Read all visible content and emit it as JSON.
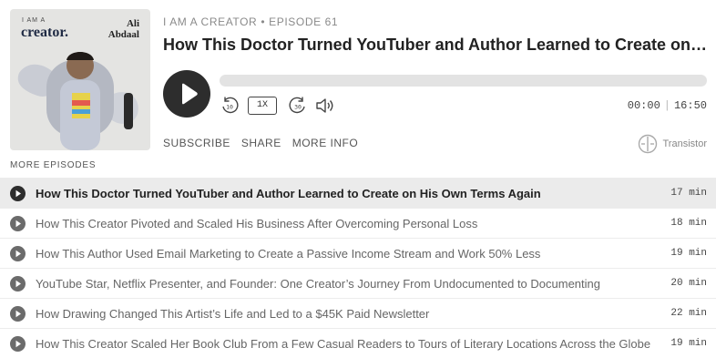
{
  "cover": {
    "small_text": "I AM A",
    "big_text": "creator.",
    "author_line1": "Ali",
    "author_line2": "Abdaal"
  },
  "podcast": {
    "show": "I AM A CREATOR",
    "separator": "•",
    "episode": "EPISODE 61",
    "title": "How This Doctor Turned YouTuber and Author Learned to Create on His Own Terms Again"
  },
  "player": {
    "speed_label": "1X",
    "rewind_seconds": "10",
    "forward_seconds": "30",
    "current_time": "00:00",
    "duration": "16:50",
    "progress_fraction": 0,
    "icons": [
      "play-icon",
      "rewind-10-icon",
      "forward-30-icon",
      "volume-icon"
    ]
  },
  "links": {
    "subscribe": "SUBSCRIBE",
    "share": "SHARE",
    "more_info": "MORE INFO"
  },
  "brand": {
    "name": "Transistor"
  },
  "episodes_label": "MORE EPISODES",
  "episodes": [
    {
      "title": "How This Doctor Turned YouTuber and Author Learned to Create on His Own Terms Again",
      "duration": "17 min",
      "active": true
    },
    {
      "title": "How This Creator Pivoted and Scaled His Business After Overcoming Personal Loss",
      "duration": "18 min",
      "active": false
    },
    {
      "title": "How This Author Used Email Marketing to Create a Passive Income Stream and Work 50% Less",
      "duration": "19 min",
      "active": false
    },
    {
      "title": "YouTube Star, Netflix Presenter, and Founder: One Creator’s Journey From Undocumented to Documenting",
      "duration": "20 min",
      "active": false
    },
    {
      "title": "How Drawing Changed This Artist’s Life and Led to a $45K Paid Newsletter",
      "duration": "22 min",
      "active": false
    },
    {
      "title": "How This Creator Scaled Her Book Club From a Few Casual Readers to Tours of Literary Locations Across the Globe",
      "duration": "19 min",
      "active": false
    }
  ],
  "colors": {
    "play_button": "#2d2d2d",
    "progress_track": "#e3e3e3",
    "active_row": "#ebebeb",
    "inactive_play_icon": "#6b6b6b"
  }
}
